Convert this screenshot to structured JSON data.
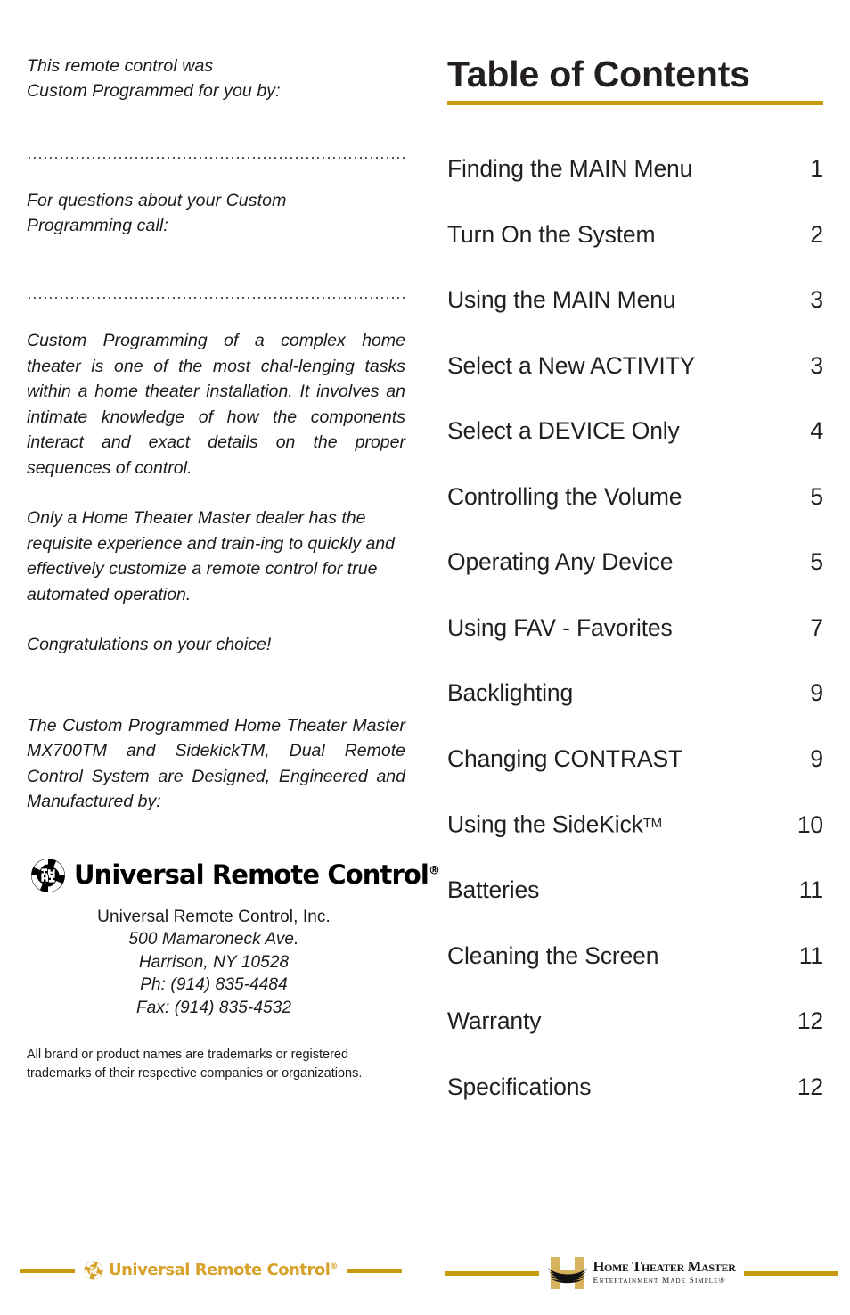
{
  "left_column": {
    "intro": {
      "line1": "This remote control was",
      "line2": "Custom Programmed for you by:"
    },
    "questions": {
      "line1": "For questions about your Custom",
      "line2": "Programming call:"
    },
    "body_paragraph_1": "Custom Programming of a complex home theater is one of the most chal-lenging tasks within a home theater installation. It involves an intimate knowledge of how the components interact and exact details on the proper sequences of control.",
    "body_paragraph_2": "Only a Home Theater Master dealer has the requisite experience and train-ing to quickly and effectively customize a remote control for true automated operation.",
    "congratulations": "Congratulations on your choice!",
    "manufacturer_statement": "The Custom Programmed Home Theater Master MX700TM and SidekickTM, Dual Remote Control System are Designed, Engineered and Manufactured by:",
    "logo": {
      "wordmark": "Universal Remote Control",
      "registered_symbol": "®"
    },
    "address": {
      "company": "Universal Remote Control, Inc.",
      "street": "500 Mamaroneck Ave.",
      "city_state_zip": "Harrison, NY 10528",
      "phone": "Ph: (914) 835-4484",
      "fax": "Fax: (914) 835-4532"
    },
    "legal_notice": "All brand or product names are trademarks or registered trademarks of their respective companies or organizations."
  },
  "right_column": {
    "title": "Table of Contents",
    "entries": [
      {
        "label": "Finding the MAIN Menu",
        "page": "1"
      },
      {
        "label": "Turn On the System",
        "page": "2"
      },
      {
        "label": "Using the MAIN Menu",
        "page": "3"
      },
      {
        "label": "Select a New ACTIVITY",
        "page": "3"
      },
      {
        "label": "Select a DEVICE Only",
        "page": "4"
      },
      {
        "label": "Controlling the Volume",
        "page": "5"
      },
      {
        "label": "Operating Any Device",
        "page": "5"
      },
      {
        "label": "Using FAV - Favorites",
        "page": "7"
      },
      {
        "label": "Backlighting",
        "page": "9"
      },
      {
        "label": "Changing CONTRAST",
        "page": "9"
      },
      {
        "label": "Using the SideKick",
        "page": "10",
        "tm": "TM"
      },
      {
        "label": "Batteries",
        "page": "11"
      },
      {
        "label": "Cleaning the Screen",
        "page": "11"
      },
      {
        "label": "Warranty",
        "page": "12"
      },
      {
        "label": "Specifications",
        "page": "12"
      }
    ]
  },
  "footer": {
    "left_logo": {
      "wordmark": "Universal Remote Control",
      "registered_symbol": "®"
    },
    "right_logo": {
      "title": "Home Theater Master",
      "tagline": "Entertainment Made Simple",
      "registered_symbol": "®"
    }
  },
  "colors": {
    "gold_rule": "#c89a0d",
    "footer_gold": "#d8a22a",
    "text": "#231f20"
  }
}
